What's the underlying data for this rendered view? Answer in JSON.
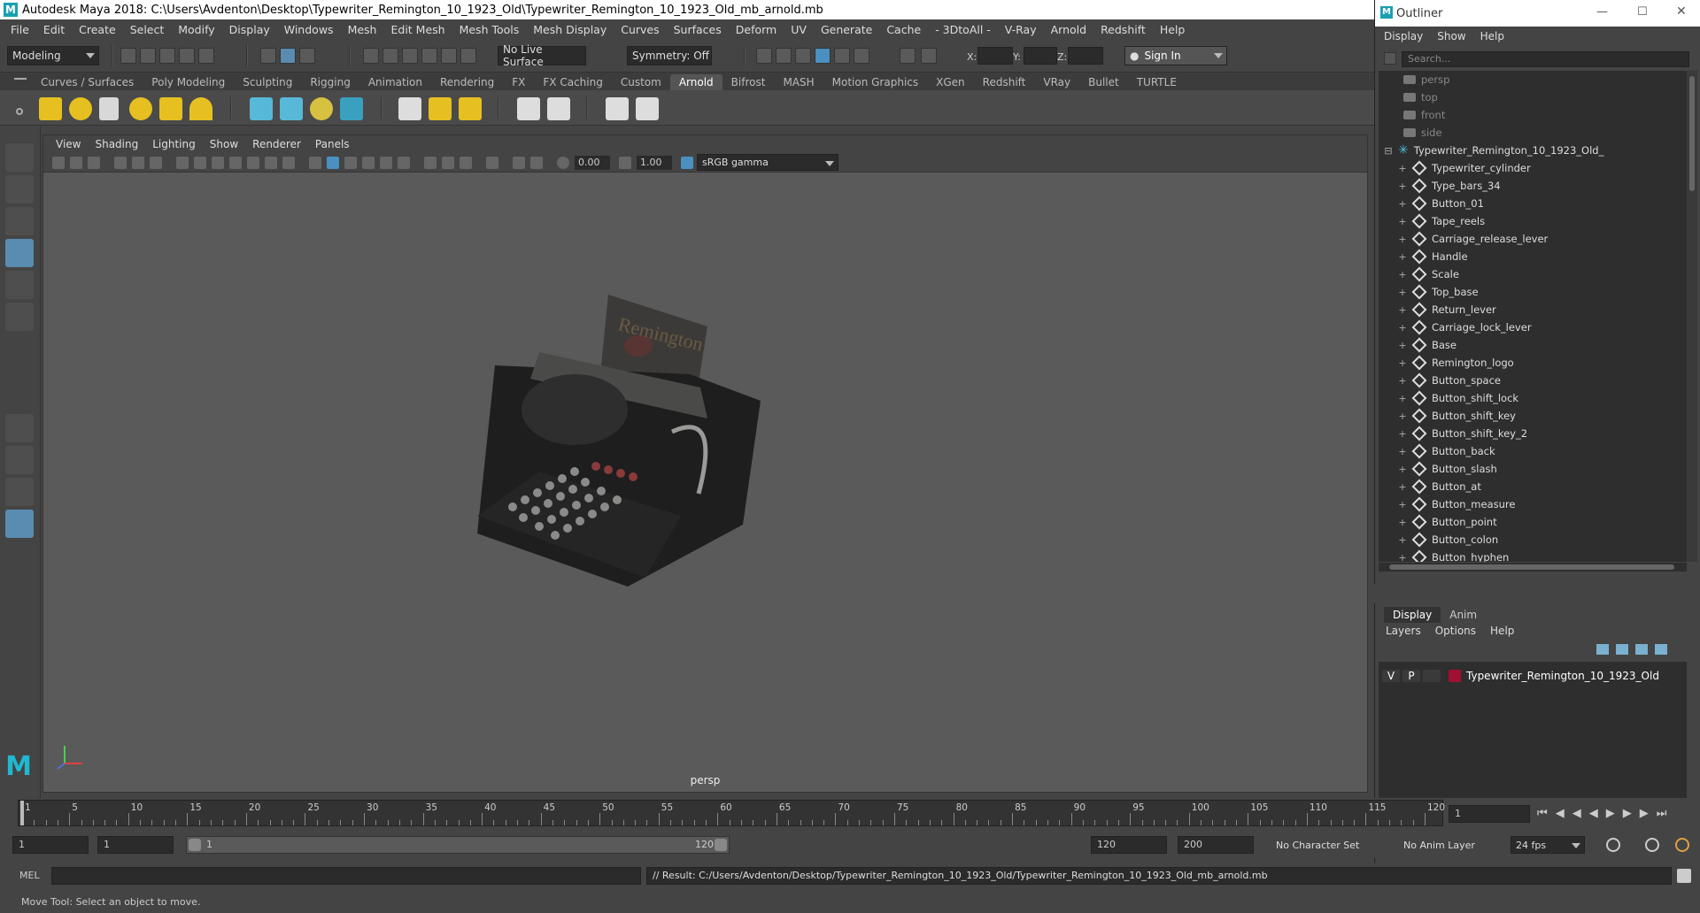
{
  "window": {
    "title": "Autodesk Maya 2018: C:\\Users\\Avdenton\\Desktop\\Typewriter_Remington_10_1923_Old\\Typewriter_Remington_10_1923_Old_mb_arnold.mb"
  },
  "menubar": [
    "File",
    "Edit",
    "Create",
    "Select",
    "Modify",
    "Display",
    "Windows",
    "Mesh",
    "Edit Mesh",
    "Mesh Tools",
    "Mesh Display",
    "Curves",
    "Surfaces",
    "Deform",
    "UV",
    "Generate",
    "Cache",
    "- 3DtoAll -",
    "V-Ray",
    "Arnold",
    "Redshift",
    "Help"
  ],
  "statusline": {
    "mode": "Modeling",
    "live_surface": "No Live Surface",
    "symmetry": "Symmetry: Off",
    "x_label": "X:",
    "y_label": "Y:",
    "z_label": "Z:",
    "sign_in": "Sign In"
  },
  "shelf_tabs": [
    "Curves / Surfaces",
    "Poly Modeling",
    "Sculpting",
    "Rigging",
    "Animation",
    "Rendering",
    "FX",
    "FX Caching",
    "Custom",
    "Arnold",
    "Bifrost",
    "MASH",
    "Motion Graphics",
    "XGen",
    "Redshift",
    "VRay",
    "Bullet",
    "TURTLE"
  ],
  "active_shelf": "Arnold",
  "viewport": {
    "menu": [
      "View",
      "Shading",
      "Lighting",
      "Show",
      "Renderer",
      "Panels"
    ],
    "exposure": "0.00",
    "gamma": "1.00",
    "color_space": "sRGB gamma",
    "camera": "persp",
    "render_text": "Remington"
  },
  "outliner": {
    "title": "Outliner",
    "menu": [
      "Display",
      "Show",
      "Help"
    ],
    "search_placeholder": "Search...",
    "cameras": [
      "persp",
      "top",
      "front",
      "side"
    ],
    "group": "Typewriter_Remington_10_1923_Old_",
    "children": [
      "Typewriter_cylinder",
      "Type_bars_34",
      "Button_01",
      "Tape_reels",
      "Carriage_release_lever",
      "Handle",
      "Scale",
      "Top_base",
      "Return_lever",
      "Carriage_lock_lever",
      "Base",
      "Remington_logo",
      "Button_space",
      "Button_shift_lock",
      "Button_shift_key",
      "Button_shift_key_2",
      "Button_back",
      "Button_slash",
      "Button_at",
      "Button_measure",
      "Button_point",
      "Button_colon",
      "Button_hyphen"
    ]
  },
  "layer_editor": {
    "tabs": [
      "Display",
      "Anim"
    ],
    "menu": [
      "Layers",
      "Options",
      "Help"
    ],
    "layer": {
      "v": "V",
      "p": "P",
      "name": "Typewriter_Remington_10_1923_Old",
      "color": "#a01030"
    }
  },
  "timeline": {
    "ticks": [
      1,
      5,
      10,
      15,
      20,
      25,
      30,
      35,
      40,
      45,
      50,
      55,
      60,
      65,
      70,
      75,
      80,
      85,
      90,
      95,
      100,
      105,
      110,
      115,
      120
    ],
    "current_frame": "1"
  },
  "range": {
    "start": "1",
    "anim_start": "1",
    "slider_start": "1",
    "slider_end": "120",
    "end": "120",
    "anim_end": "200",
    "character_set": "No Character Set",
    "anim_layer": "No Anim Layer",
    "fps": "24 fps"
  },
  "command": {
    "label": "MEL",
    "result": "// Result: C:/Users/Avdenton/Desktop/Typewriter_Remington_10_1923_Old/Typewriter_Remington_10_1923_Old_mb_arnold.mb"
  },
  "help_line": "Move Tool: Select an object to move."
}
